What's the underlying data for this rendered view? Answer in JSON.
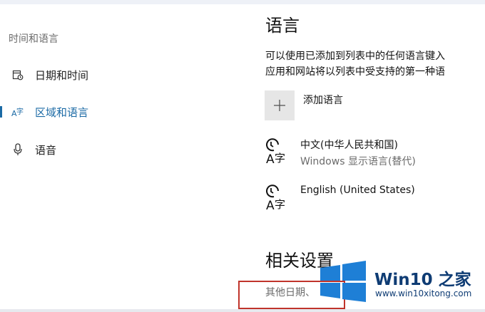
{
  "sidebar": {
    "title": "时间和语言",
    "items": [
      {
        "label": "日期和时间",
        "icon": "calendar-clock-icon"
      },
      {
        "label": "区域和语言",
        "icon": "region-language-icon",
        "active": true
      },
      {
        "label": "语音",
        "icon": "microphone-icon"
      }
    ]
  },
  "main": {
    "title": "语言",
    "desc_line1": "可以使用已添加到列表中的任何语言键入",
    "desc_line2": "应用和网站将以列表中受支持的第一种语",
    "add_label": "添加语言",
    "languages": [
      {
        "name": "中文(中华人民共和国)",
        "sub": "Windows 显示语言(替代)"
      },
      {
        "name": "English (United States)",
        "sub": ""
      }
    ],
    "related_title": "相关设置",
    "other_link": "其他日期、"
  },
  "watermark": {
    "brand": "Win10 之家",
    "url": "www.win10xitong.com"
  },
  "colors": {
    "accent": "#1b6aa5",
    "highlight_box": "#c0342b",
    "watermark": "#0f3c74"
  }
}
